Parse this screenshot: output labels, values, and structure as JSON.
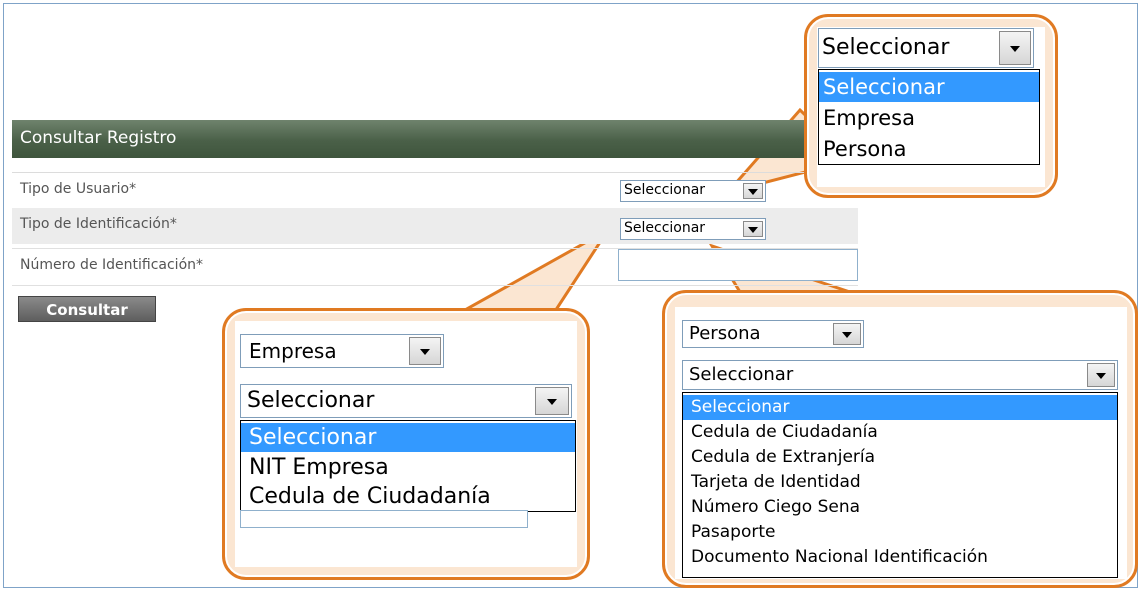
{
  "page": {
    "title": "Consultar Registro",
    "submit_label": "Consultar"
  },
  "form": {
    "tipo_usuario": {
      "label": "Tipo de Usuario*",
      "value": "Seleccionar"
    },
    "tipo_identificacion": {
      "label": "Tipo de Identificación*",
      "value": "Seleccionar"
    },
    "numero_identificacion": {
      "label": "Número de Identificación*",
      "value": ""
    }
  },
  "callout_user_type": {
    "select_value": "Seleccionar",
    "options": [
      "Seleccionar",
      "Empresa",
      "Persona"
    ],
    "highlighted_option": "Seleccionar"
  },
  "callout_empresa": {
    "user_type_value": "Empresa",
    "id_type_value": "Seleccionar",
    "options": [
      "Seleccionar",
      "NIT Empresa",
      "Cedula de Ciudadanía"
    ],
    "highlighted_option": "Seleccionar"
  },
  "callout_persona": {
    "user_type_value": "Persona",
    "id_type_value": "Seleccionar",
    "options": [
      "Seleccionar",
      "Cedula de Ciudadanía",
      "Cedula de Extranjería",
      "Tarjeta de Identidad",
      "Número Ciego Sena",
      "Pasaporte",
      "Documento Nacional Identificación"
    ],
    "highlighted_option": "Seleccionar"
  },
  "colors": {
    "callout_border": "#e07a22",
    "callout_fill": "#fbe6d2",
    "highlight": "#3399ff",
    "title_bar": "#4a6048"
  },
  "icons": [
    "dropdown-arrow-icon"
  ]
}
